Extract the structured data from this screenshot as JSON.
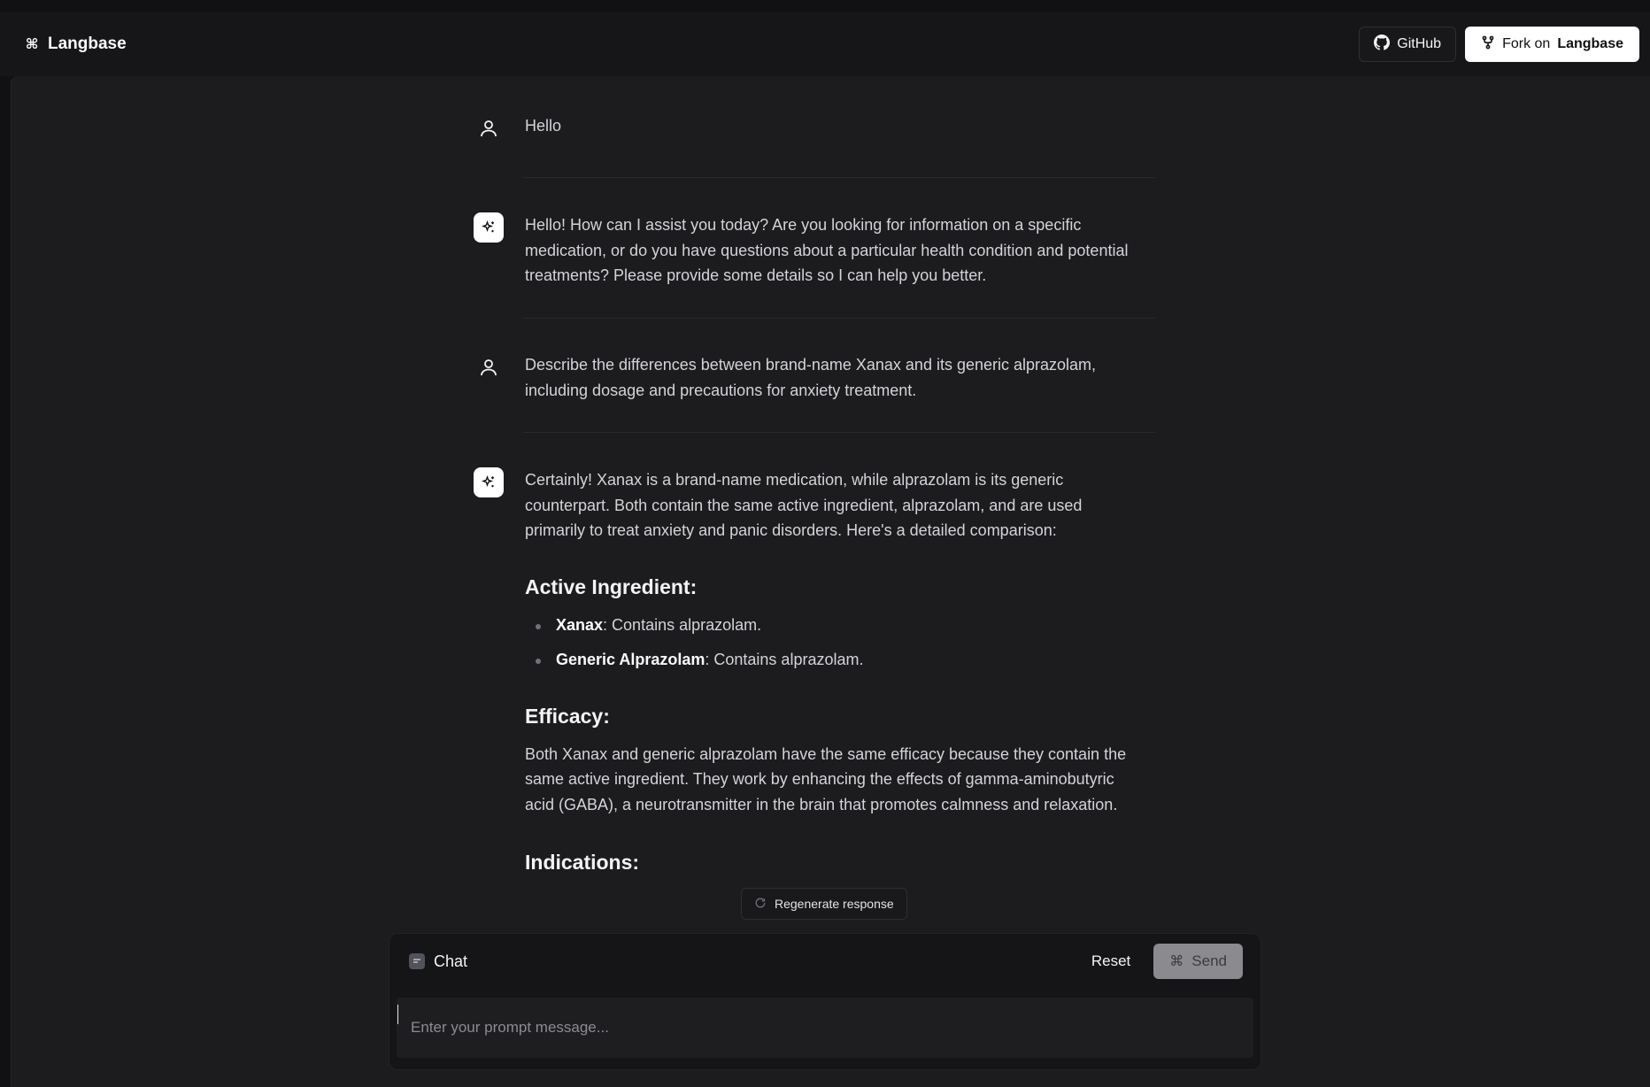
{
  "header": {
    "brand": "Langbase",
    "github_label": "GitHub",
    "fork_prefix": "Fork on",
    "fork_brand": "Langbase"
  },
  "messages": [
    {
      "role": "user",
      "text": "Hello"
    },
    {
      "role": "assistant",
      "text": "Hello! How can I assist you today? Are you looking for information on a specific medication, or do you have questions about a particular health condition and potential treatments? Please provide some details so I can help you better."
    },
    {
      "role": "user",
      "text": "Describe the differences between brand-name Xanax and its generic alprazolam, including dosage and precautions for anxiety treatment."
    },
    {
      "role": "assistant",
      "intro": "Certainly! Xanax is a brand-name medication, while alprazolam is its generic counterpart. Both contain the same active ingredient, alprazolam, and are used primarily to treat anxiety and panic disorders. Here's a detailed comparison:",
      "sections": {
        "active_heading": "Active Ingredient:",
        "active_items": [
          {
            "term": "Xanax",
            "desc": ": Contains alprazolam."
          },
          {
            "term": "Generic Alprazolam",
            "desc": ": Contains alprazolam."
          }
        ],
        "efficacy_heading": "Efficacy:",
        "efficacy_text": "Both Xanax and generic alprazolam have the same efficacy because they contain the same active ingredient. They work by enhancing the effects of gamma-aminobutyric acid (GABA), a neurotransmitter in the brain that promotes calmness and relaxation.",
        "indications_heading": "Indications:"
      }
    }
  ],
  "regenerate_label": "Regenerate response",
  "composer": {
    "title": "Chat",
    "reset_label": "Reset",
    "send_label": "Send",
    "placeholder": "Enter your prompt message..."
  }
}
